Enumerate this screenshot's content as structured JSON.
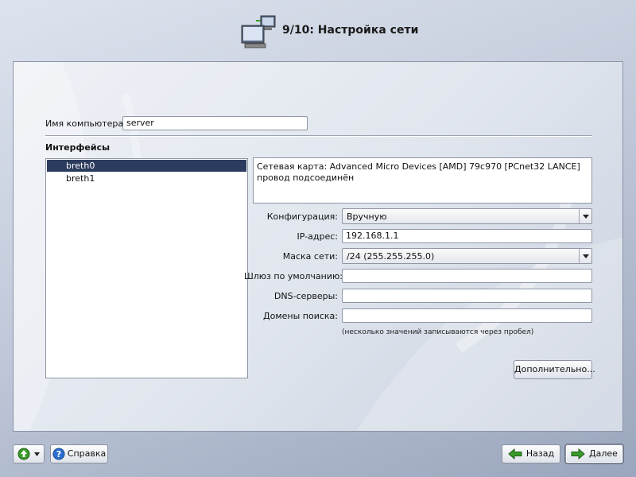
{
  "header": {
    "title": "9/10: Настройка сети",
    "icon": "network-computers-icon"
  },
  "hostname": {
    "label": "Имя компьютера:",
    "value": "server"
  },
  "interfaces": {
    "title": "Интерфейсы",
    "items": [
      {
        "label": "breth0",
        "selected": true
      },
      {
        "label": "breth1",
        "selected": false
      }
    ],
    "description_line1": "Сетевая карта: Advanced Micro Devices [AMD] 79c970 [PCnet32 LANCE]",
    "description_line2": "провод подсоединён"
  },
  "config": {
    "mode_label": "Конфигурация:",
    "mode_value": "Вручную",
    "ip_label": "IP-адрес:",
    "ip_value": "192.168.1.1",
    "mask_label": "Маска сети:",
    "mask_value": "/24 (255.255.255.0)",
    "gateway_label": "Шлюз по умолчанию:",
    "gateway_value": "",
    "dns_label": "DNS-серверы:",
    "dns_value": "",
    "domains_label": "Домены поиска:",
    "domains_value": "",
    "hint": "(несколько значений записываются через пробел)",
    "advanced_button": "Дополнительно..."
  },
  "footer": {
    "help_button": "Справка",
    "back_button": "Назад",
    "next_button": "Далее"
  },
  "colors": {
    "selection": "#2c3c5e",
    "arrow_green": "#3a9a2a",
    "help_blue": "#2a6ed0"
  }
}
